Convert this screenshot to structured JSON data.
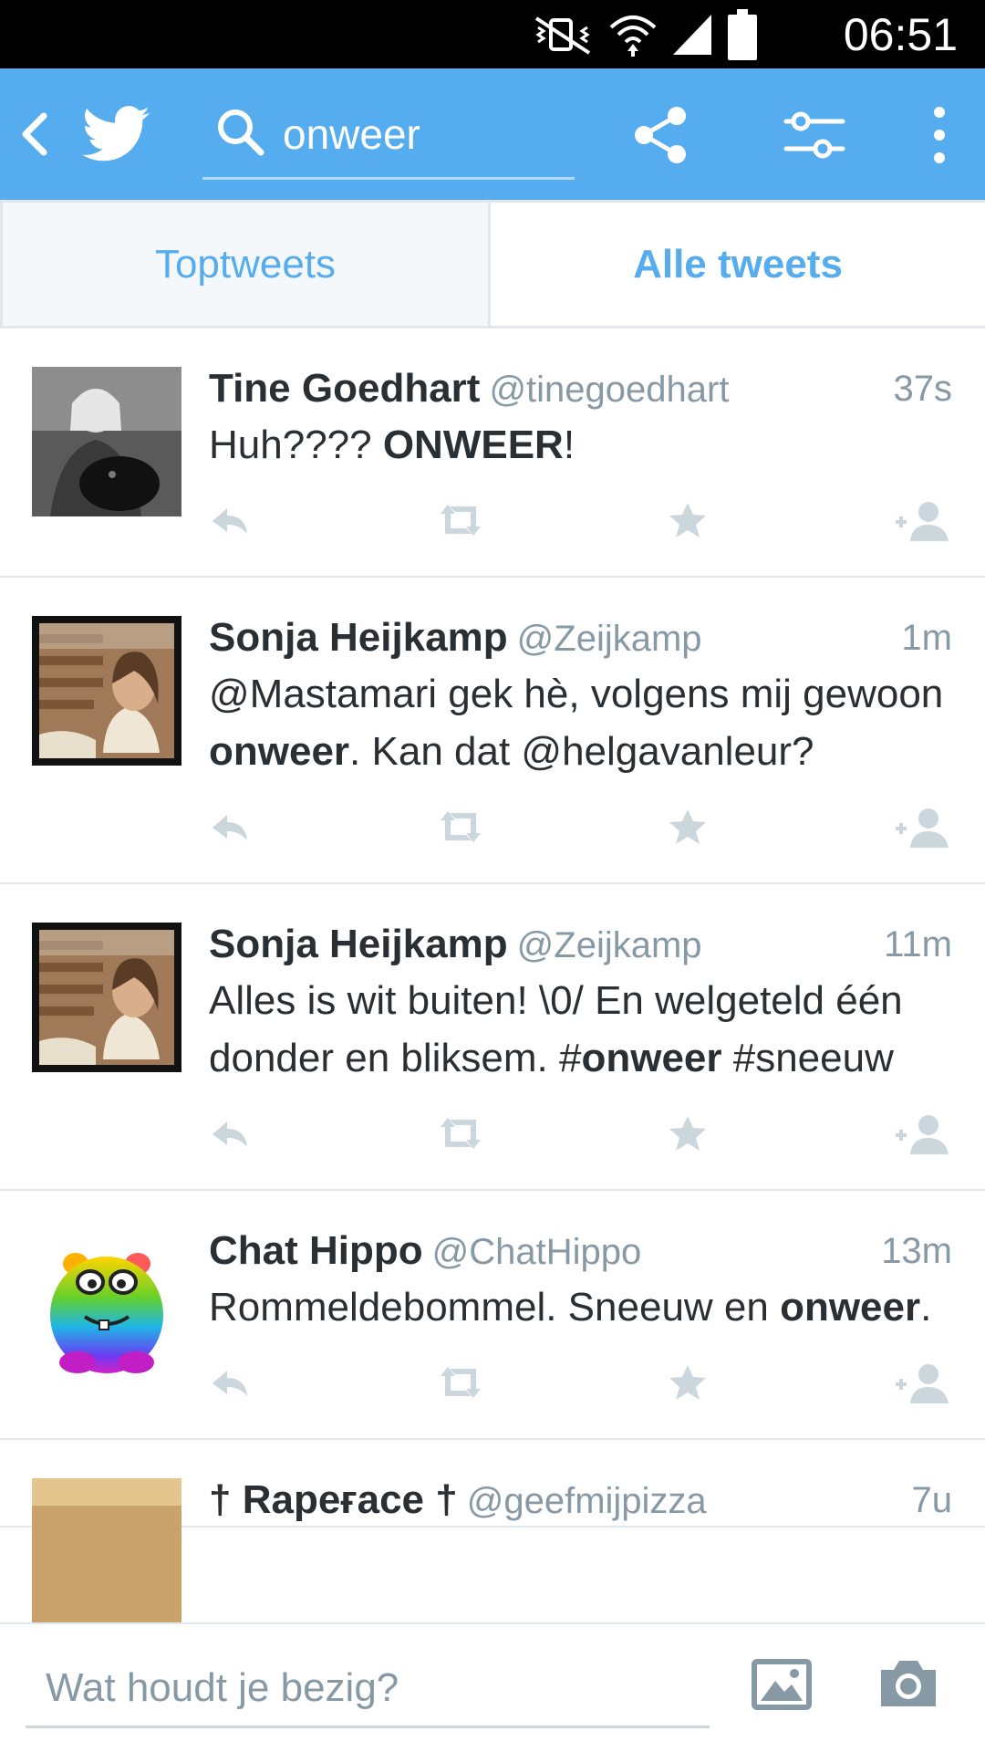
{
  "status_bar": {
    "time": "06:51"
  },
  "action_bar": {
    "search_query": "onweer",
    "icons": [
      "back-icon",
      "twitter-bird-icon",
      "search-icon",
      "share-icon",
      "filter-icon",
      "overflow-menu-icon"
    ]
  },
  "tabs": [
    {
      "label": "Toptweets",
      "selected": false
    },
    {
      "label": "Alle tweets",
      "selected": true
    }
  ],
  "tweets": [
    {
      "name": "Tine Goedhart",
      "handle": "@tinegoedhart",
      "time": "37s",
      "text": [
        {
          "t": "Huh???? "
        },
        {
          "t": "ONWEER",
          "b": true
        },
        {
          "t": "!"
        }
      ],
      "avatar": "bw-photo"
    },
    {
      "name": "Sonja Heijkamp",
      "handle": "@Zeijkamp",
      "time": "1m",
      "text": [
        {
          "t": "@Mastamari gek hè, volgens mij gewoon "
        },
        {
          "t": "onweer",
          "b": true
        },
        {
          "t": ". Kan dat @helgavanleur?"
        }
      ],
      "avatar": "polaroid"
    },
    {
      "name": "Sonja Heijkamp",
      "handle": "@Zeijkamp",
      "time": "11m",
      "text": [
        {
          "t": "Alles is wit buiten! \\0/ En welgeteld één donder en bliksem. #"
        },
        {
          "t": "onweer",
          "b": true
        },
        {
          "t": " #sneeuw"
        }
      ],
      "avatar": "polaroid"
    },
    {
      "name": "Chat Hippo",
      "handle": "@ChatHippo",
      "time": "13m",
      "text": [
        {
          "t": "Rommeldebommel. Sneeuw en "
        },
        {
          "t": "onweer",
          "b": true
        },
        {
          "t": "."
        }
      ],
      "avatar": "hippo"
    },
    {
      "name": "† Rapeғace †",
      "handle": "@geefmijpizza",
      "time": "7u",
      "text": [],
      "avatar": "partial"
    }
  ],
  "compose": {
    "placeholder": "Wat houdt je bezig?"
  },
  "colors": {
    "accent": "#55acee",
    "text": "#292f33",
    "muted": "#8899a6",
    "divider": "#e1e8ed",
    "icon": "#ccd6dd"
  }
}
